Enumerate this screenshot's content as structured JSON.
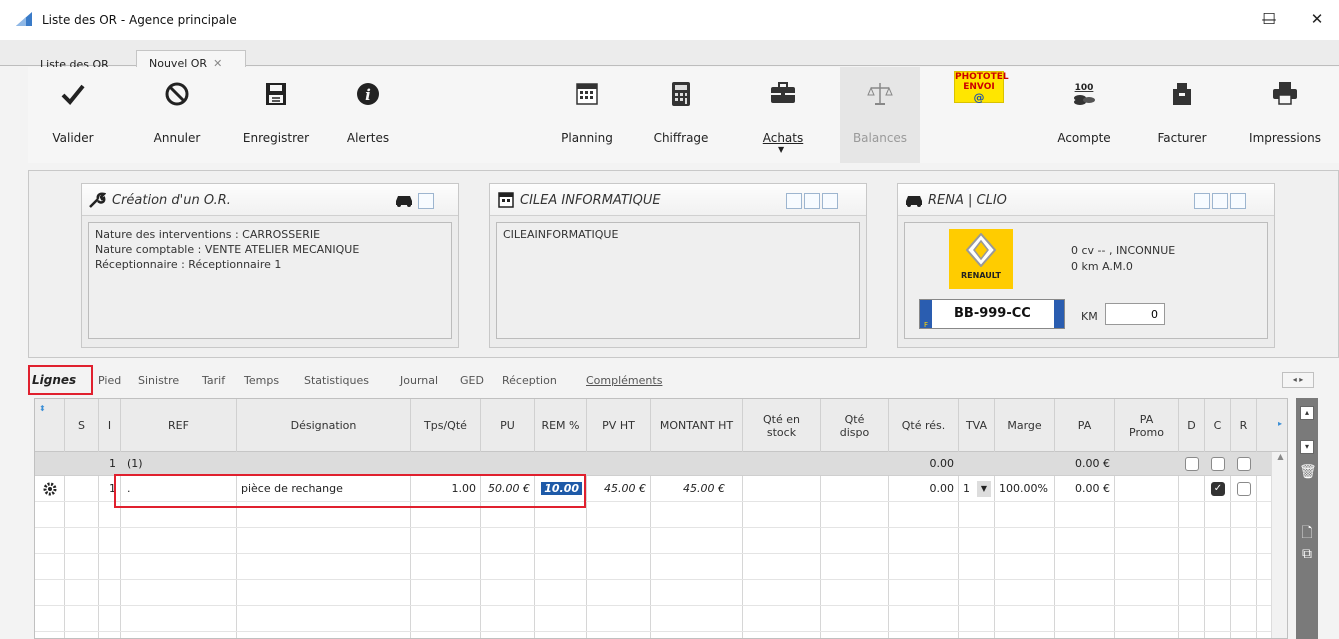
{
  "window": {
    "title": "Liste des OR - Agence principale",
    "minimize": "—",
    "maximize": "☐",
    "close": "✕"
  },
  "tabs": {
    "list": "Liste des OR",
    "new": "Nouvel OR",
    "close_glyph": "✕"
  },
  "toolbar": {
    "valider": "Valider",
    "annuler": "Annuler",
    "enregistrer": "Enregistrer",
    "alertes": "Alertes",
    "planning": "Planning",
    "chiffrage": "Chiffrage",
    "achats": "Achats",
    "balances": "Balances",
    "phototel_line1": "PHOTOTEL",
    "phototel_line2": "ENVOI",
    "acompte": "Acompte",
    "acompte_badge": "100",
    "facturer": "Facturer",
    "impressions": "Impressions"
  },
  "panel_or": {
    "title": "Création d'un O.R.",
    "line1": "Nature des interventions : CARROSSERIE",
    "line2": "Nature comptable : VENTE ATELIER MECANIQUE",
    "line3": "Réceptionnaire  : Réceptionnaire 1"
  },
  "panel_client": {
    "title": "CILEA INFORMATIQUE",
    "body": "CILEAINFORMATIQUE"
  },
  "panel_vehicle": {
    "title": "RENA | CLIO",
    "brand": "RENAULT",
    "power": "0 cv -- , INCONNUE",
    "km_line": "0 km A.M.0",
    "plate": "BB-999-CC",
    "plate_country": "F",
    "km_label": "KM",
    "km_value": "0"
  },
  "subtabs": [
    "Lignes",
    "Pied",
    "Sinistre",
    "Tarif",
    "Temps",
    "Statistiques",
    "Journal",
    "GED",
    "Réception",
    "Compléments"
  ],
  "grid": {
    "headers": {
      "s": "S",
      "i": "I",
      "ref": "REF",
      "designation": "Désignation",
      "tps": "Tps/Qté",
      "pu": "PU",
      "rem": "REM %",
      "pvht": "PV HT",
      "montant": "MONTANT HT",
      "qte_stock": "Qté en stock",
      "qte_dispo": "Qté dispo",
      "qte_res": "Qté rés.",
      "tva": "TVA",
      "marge": "Marge",
      "pa": "PA",
      "pa_promo": "PA Promo",
      "d": "D",
      "c": "C",
      "r": "R"
    },
    "group_row": {
      "i": "1",
      "ref": "(1)",
      "qte_res": "0.00",
      "pa": "0.00 €"
    },
    "line": {
      "i": "1",
      "ref": ".",
      "designation": "pièce de rechange",
      "tps": "1.00",
      "pu": "50.00 €",
      "rem": "10.00",
      "pvht": "45.00 €",
      "montant": "45.00 €",
      "qte_res": "0.00",
      "tva": "1",
      "marge": "100.00%",
      "pa": "0.00 €"
    }
  }
}
